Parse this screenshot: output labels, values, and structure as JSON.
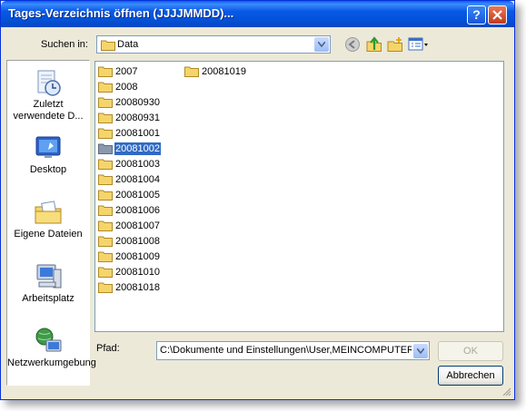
{
  "window": {
    "title": "Tages-Verzeichnis öffnen (JJJJMMDD)..."
  },
  "titlebar": {
    "help_icon": "question-mark-icon",
    "close_icon": "close-x-icon"
  },
  "lookin": {
    "label": "Suchen in:",
    "value": "Data",
    "icon": "folder-icon"
  },
  "toolbar": {
    "back_icon": "back-arrow-icon",
    "up_icon": "up-folder-icon",
    "new_folder_icon": "new-folder-icon",
    "view_icon": "view-menu-icon"
  },
  "places": [
    {
      "label": "Zuletzt verwendete D...",
      "icon": "recent-documents-icon"
    },
    {
      "label": "Desktop",
      "icon": "desktop-icon"
    },
    {
      "label": "Eigene Dateien",
      "icon": "my-documents-icon"
    },
    {
      "label": "Arbeitsplatz",
      "icon": "my-computer-icon"
    },
    {
      "label": "Netzwerkumgebung",
      "icon": "network-places-icon"
    }
  ],
  "files": {
    "column1": [
      "2007",
      "2008",
      "20080930",
      "20080931",
      "20081001",
      "20081002",
      "20081003",
      "20081004",
      "20081005",
      "20081006",
      "20081007",
      "20081008",
      "20081009",
      "20081010",
      "20081018"
    ],
    "column2": [
      "20081019"
    ],
    "selected": "20081002"
  },
  "path": {
    "label": "Pfad:",
    "value": "C:\\Dokumente und Einstellungen\\User,MEINCOMPUTER\\A"
  },
  "buttons": {
    "ok": "OK",
    "cancel": "Abbrechen"
  }
}
